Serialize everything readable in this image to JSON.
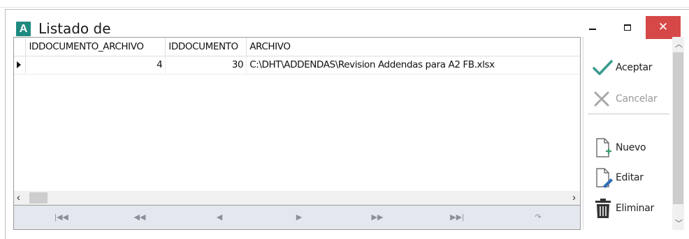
{
  "window": {
    "title": "Listado de",
    "app_letter": "A"
  },
  "grid": {
    "columns": [
      "IDDOCUMENTO_ARCHIVO",
      "IDDOCUMENTO",
      "ARCHIVO"
    ],
    "rows": [
      {
        "IDDOCUMENTO_ARCHIVO": "4",
        "IDDOCUMENTO": "30",
        "ARCHIVO": "C:\\DHT\\ADDENDAS\\Revision Addendas para A2 FB.xlsx"
      }
    ]
  },
  "actions": {
    "aceptar": "Aceptar",
    "cancelar": "Cancelar",
    "nuevo": "Nuevo",
    "editar": "Editar",
    "eliminar": "Eliminar"
  },
  "navigator": {
    "buttons": [
      "first",
      "prev-page",
      "prev",
      "next",
      "next-page",
      "last",
      "refresh"
    ]
  },
  "colors": {
    "accent": "#1f8a80",
    "close": "#d64848",
    "check": "#3a9a8e"
  }
}
